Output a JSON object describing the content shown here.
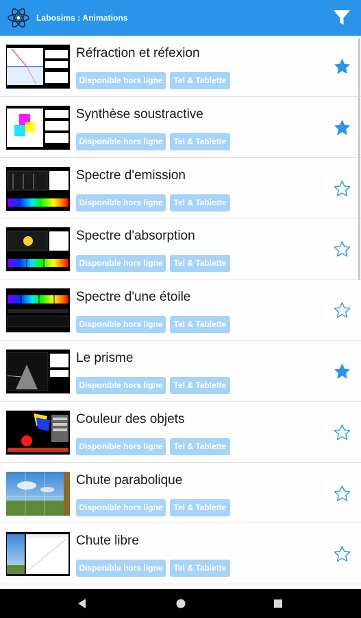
{
  "app": {
    "title": "Labosims : Animations",
    "accent_color": "#2a94ea"
  },
  "badges": {
    "offline": "Disponible hors ligne",
    "device": "Tel & Tablette"
  },
  "items": [
    {
      "title": "Réfraction et réfexion",
      "favorite": true
    },
    {
      "title": "Synthèse soustractive",
      "favorite": true
    },
    {
      "title": "Spectre d'emission",
      "favorite": false
    },
    {
      "title": "Spectre d'absorption",
      "favorite": false
    },
    {
      "title": "Spectre d'une étoile",
      "favorite": false
    },
    {
      "title": "Le prisme",
      "favorite": true
    },
    {
      "title": "Couleur des objets",
      "favorite": false
    },
    {
      "title": "Chute parabolique",
      "favorite": false
    },
    {
      "title": "Chute libre",
      "favorite": false
    }
  ],
  "icons": {
    "logo": "atom-icon",
    "filter": "filter-icon",
    "favorite": "star-icon",
    "nav_back": "back-triangle-icon",
    "nav_home": "home-circle-icon",
    "nav_recents": "recents-square-icon"
  }
}
